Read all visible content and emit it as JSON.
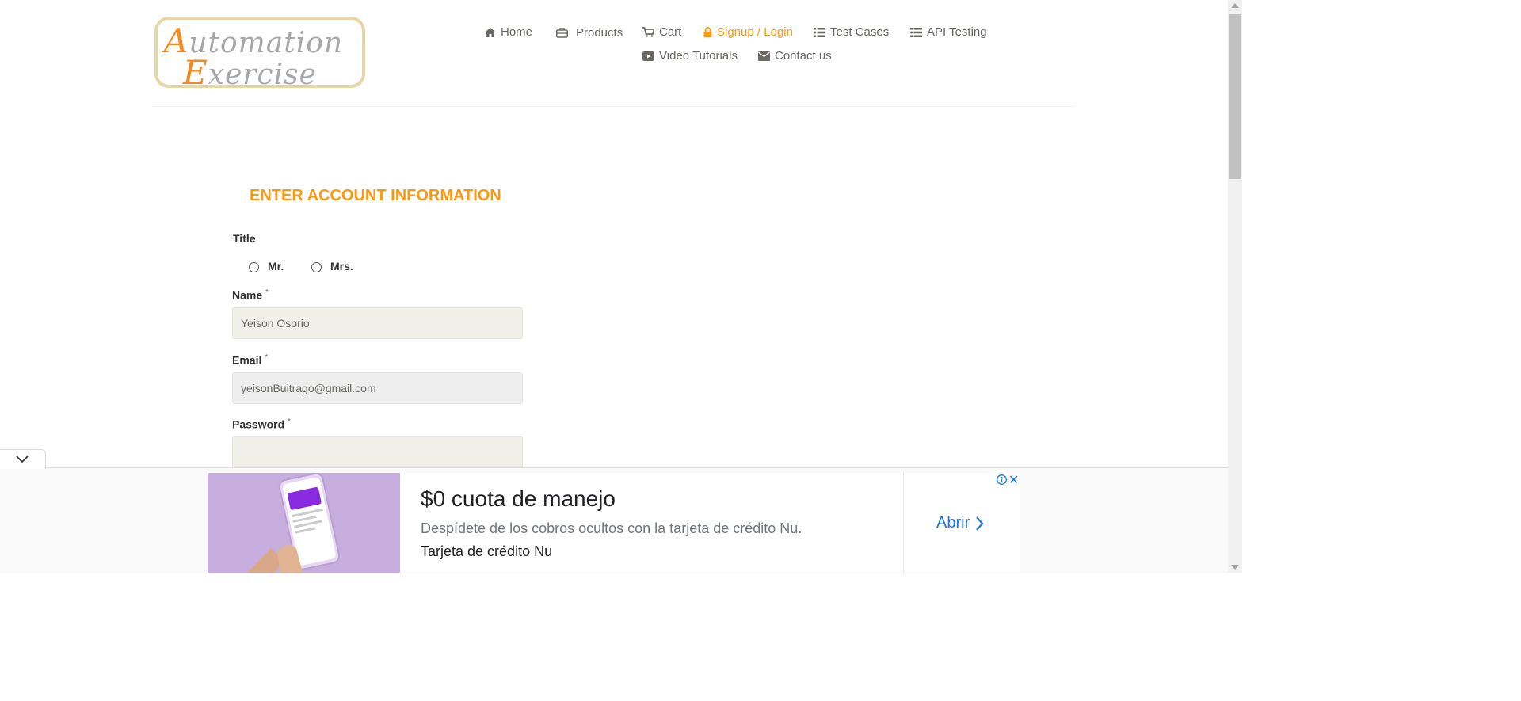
{
  "brand": {
    "logo_line1_first": "A",
    "logo_line1_rest": "utomation",
    "logo_line2_first": "E",
    "logo_line2_rest": "xercise"
  },
  "nav": {
    "home": "Home",
    "products": "Products",
    "cart": "Cart",
    "signup_login": "Signup / Login",
    "test_cases": "Test Cases",
    "api_testing": "API Testing",
    "video_tutorials": "Video Tutorials",
    "contact_us": "Contact us",
    "active_color": "#fe980f"
  },
  "form": {
    "section_title": "ENTER ACCOUNT INFORMATION",
    "title_label": "Title",
    "title_options": [
      "Mr.",
      "Mrs."
    ],
    "name_label": "Name",
    "name_value": "Yeison Osorio",
    "email_label": "Email",
    "email_value": "yeisonBuitrago@gmail.com",
    "password_label": "Password",
    "password_value": "",
    "required_mark": "*"
  },
  "ad": {
    "title": "$0 cuota de manejo",
    "description": "Despídete de los cobros ocultos con la tarjeta de crédito Nu.",
    "brand": "Tarjeta de crédito Nu",
    "cta": "Abrir",
    "close": "✕"
  },
  "colors": {
    "accent": "#fe980f",
    "link": "#1a73e8"
  }
}
